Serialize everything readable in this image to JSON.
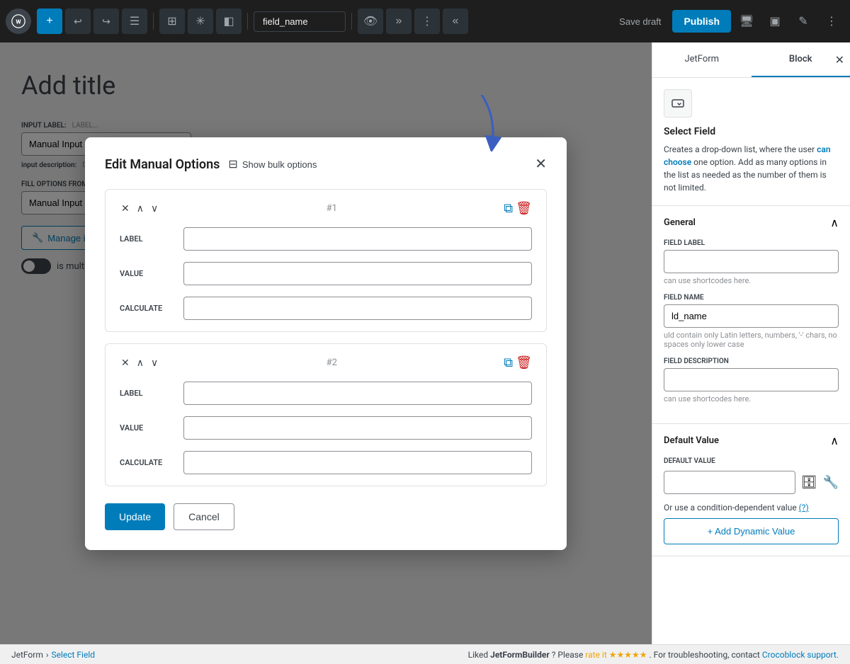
{
  "toolbar": {
    "field_name_value": "field_name",
    "save_draft_label": "Save draft",
    "publish_label": "Publish"
  },
  "editor": {
    "add_title": "Add title",
    "input_label": "INPUT LABEL:",
    "input_label_value": "LABEL...",
    "manual_input_value": "Manual Input",
    "input_description_label": "input description:",
    "input_description_placeholder": "Description...",
    "fill_options_from": "FILL OPTIONS FROM",
    "fill_options_value": "Manual Input",
    "manage_items_label": "Manage items",
    "is_multiple_label": "is multiple"
  },
  "sidebar": {
    "jetform_tab": "JetForm",
    "block_tab": "Block",
    "select_field_title": "Select Field",
    "select_field_desc": "Creates a drop-down list, where the user can choose one option. Add as many options in the list as needed as the number of them is not limited.",
    "general_section": "eral",
    "field_label_section": "O LABEL",
    "shortcodes_hint": "can use shortcodes here.",
    "field_name_section": "M FIELD NAME",
    "field_name_value": "ld_name",
    "field_name_warning": "uld contain only Latin letters, numbers, '-' chars, no spaces only lower case",
    "description_section": "O DESCRIPTION",
    "description_hint": "can use shortcodes here.",
    "default_value_section": "e",
    "ult_value_label": "ULT VALUE",
    "condition_text": "Or use a condition-dependent value",
    "condition_link": "(?)",
    "add_dynamic_label": "+ Add Dynamic Value"
  },
  "modal": {
    "title": "Edit Manual Options",
    "show_bulk_label": "Show bulk options",
    "item1_num": "#1",
    "item2_num": "#2",
    "label_field": "LABEL",
    "value_field": "VALUE",
    "calculate_field": "CALCULATE",
    "update_label": "Update",
    "cancel_label": "Cancel"
  },
  "status_bar": {
    "jetform_label": "JetForm",
    "separator": "›",
    "select_field_label": "Select Field",
    "liked_text": "Liked",
    "jetformbuilder_text": "JetFormBuilder",
    "rate_text": "rate it ★★★★★",
    "troubleshoot_text": ". For troubleshooting, contact",
    "crocoblock_text": "Crocoblock support."
  },
  "icons": {
    "wp_logo": "W",
    "plus": "+",
    "undo": "↩",
    "redo": "↪",
    "list": "☰",
    "grid": "⊞",
    "asterisk": "✳",
    "layers": "◧",
    "eye": "👁",
    "chevron_right": "»",
    "dots": "⋮",
    "chevron_left": "«",
    "monitor": "⬜",
    "sidebar_toggle": "▣",
    "pen": "✎",
    "more": "⋮",
    "wrench": "🔧",
    "chevron_up": "∧",
    "chevron_down": "∨",
    "cross": "✕",
    "copy": "⧉",
    "trash": "🗑",
    "table_icon": "⊟",
    "database": "🗄",
    "wrench_blue": "🔧"
  }
}
